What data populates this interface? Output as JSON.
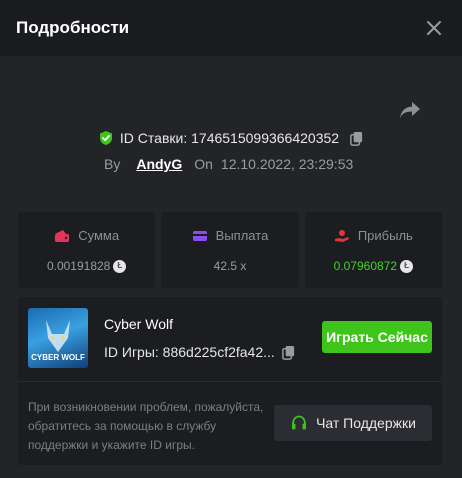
{
  "header": {
    "title": "Подробности"
  },
  "bet": {
    "id_label": "ID Ставки: 1746515099366420352",
    "by_label": "By",
    "user": "AndyG",
    "on_label": "On",
    "date": "12.10.2022, 23:29:53"
  },
  "stats": [
    {
      "label": "Сумма",
      "value": "0.00191828",
      "icon": "wallet-icon",
      "icon_color": "#e4345a"
    },
    {
      "label": "Выплата",
      "value": "42.5 x",
      "icon": "card-icon",
      "icon_color": "#8a4cf0"
    },
    {
      "label": "Прибыль",
      "value": "0.07960872",
      "icon": "hand-coin-icon",
      "icon_color": "#e0363c"
    }
  ],
  "game": {
    "name": "Cyber Wolf",
    "id_label": "ID Игры: 886d225cf2fa42...",
    "thumb_text": "CYBER WOLF",
    "play_label": "Играть Сейчас",
    "help_text": "При возникновении проблем, пожалуйста, обратитесь за помощью в службу поддержки и укажите ID игры.",
    "support_label": "Чат Поддержки"
  },
  "colors": {
    "accent_green": "#3fc41b",
    "profit_green": "#46d12b",
    "background": "#232428",
    "card": "#1c1d21"
  }
}
